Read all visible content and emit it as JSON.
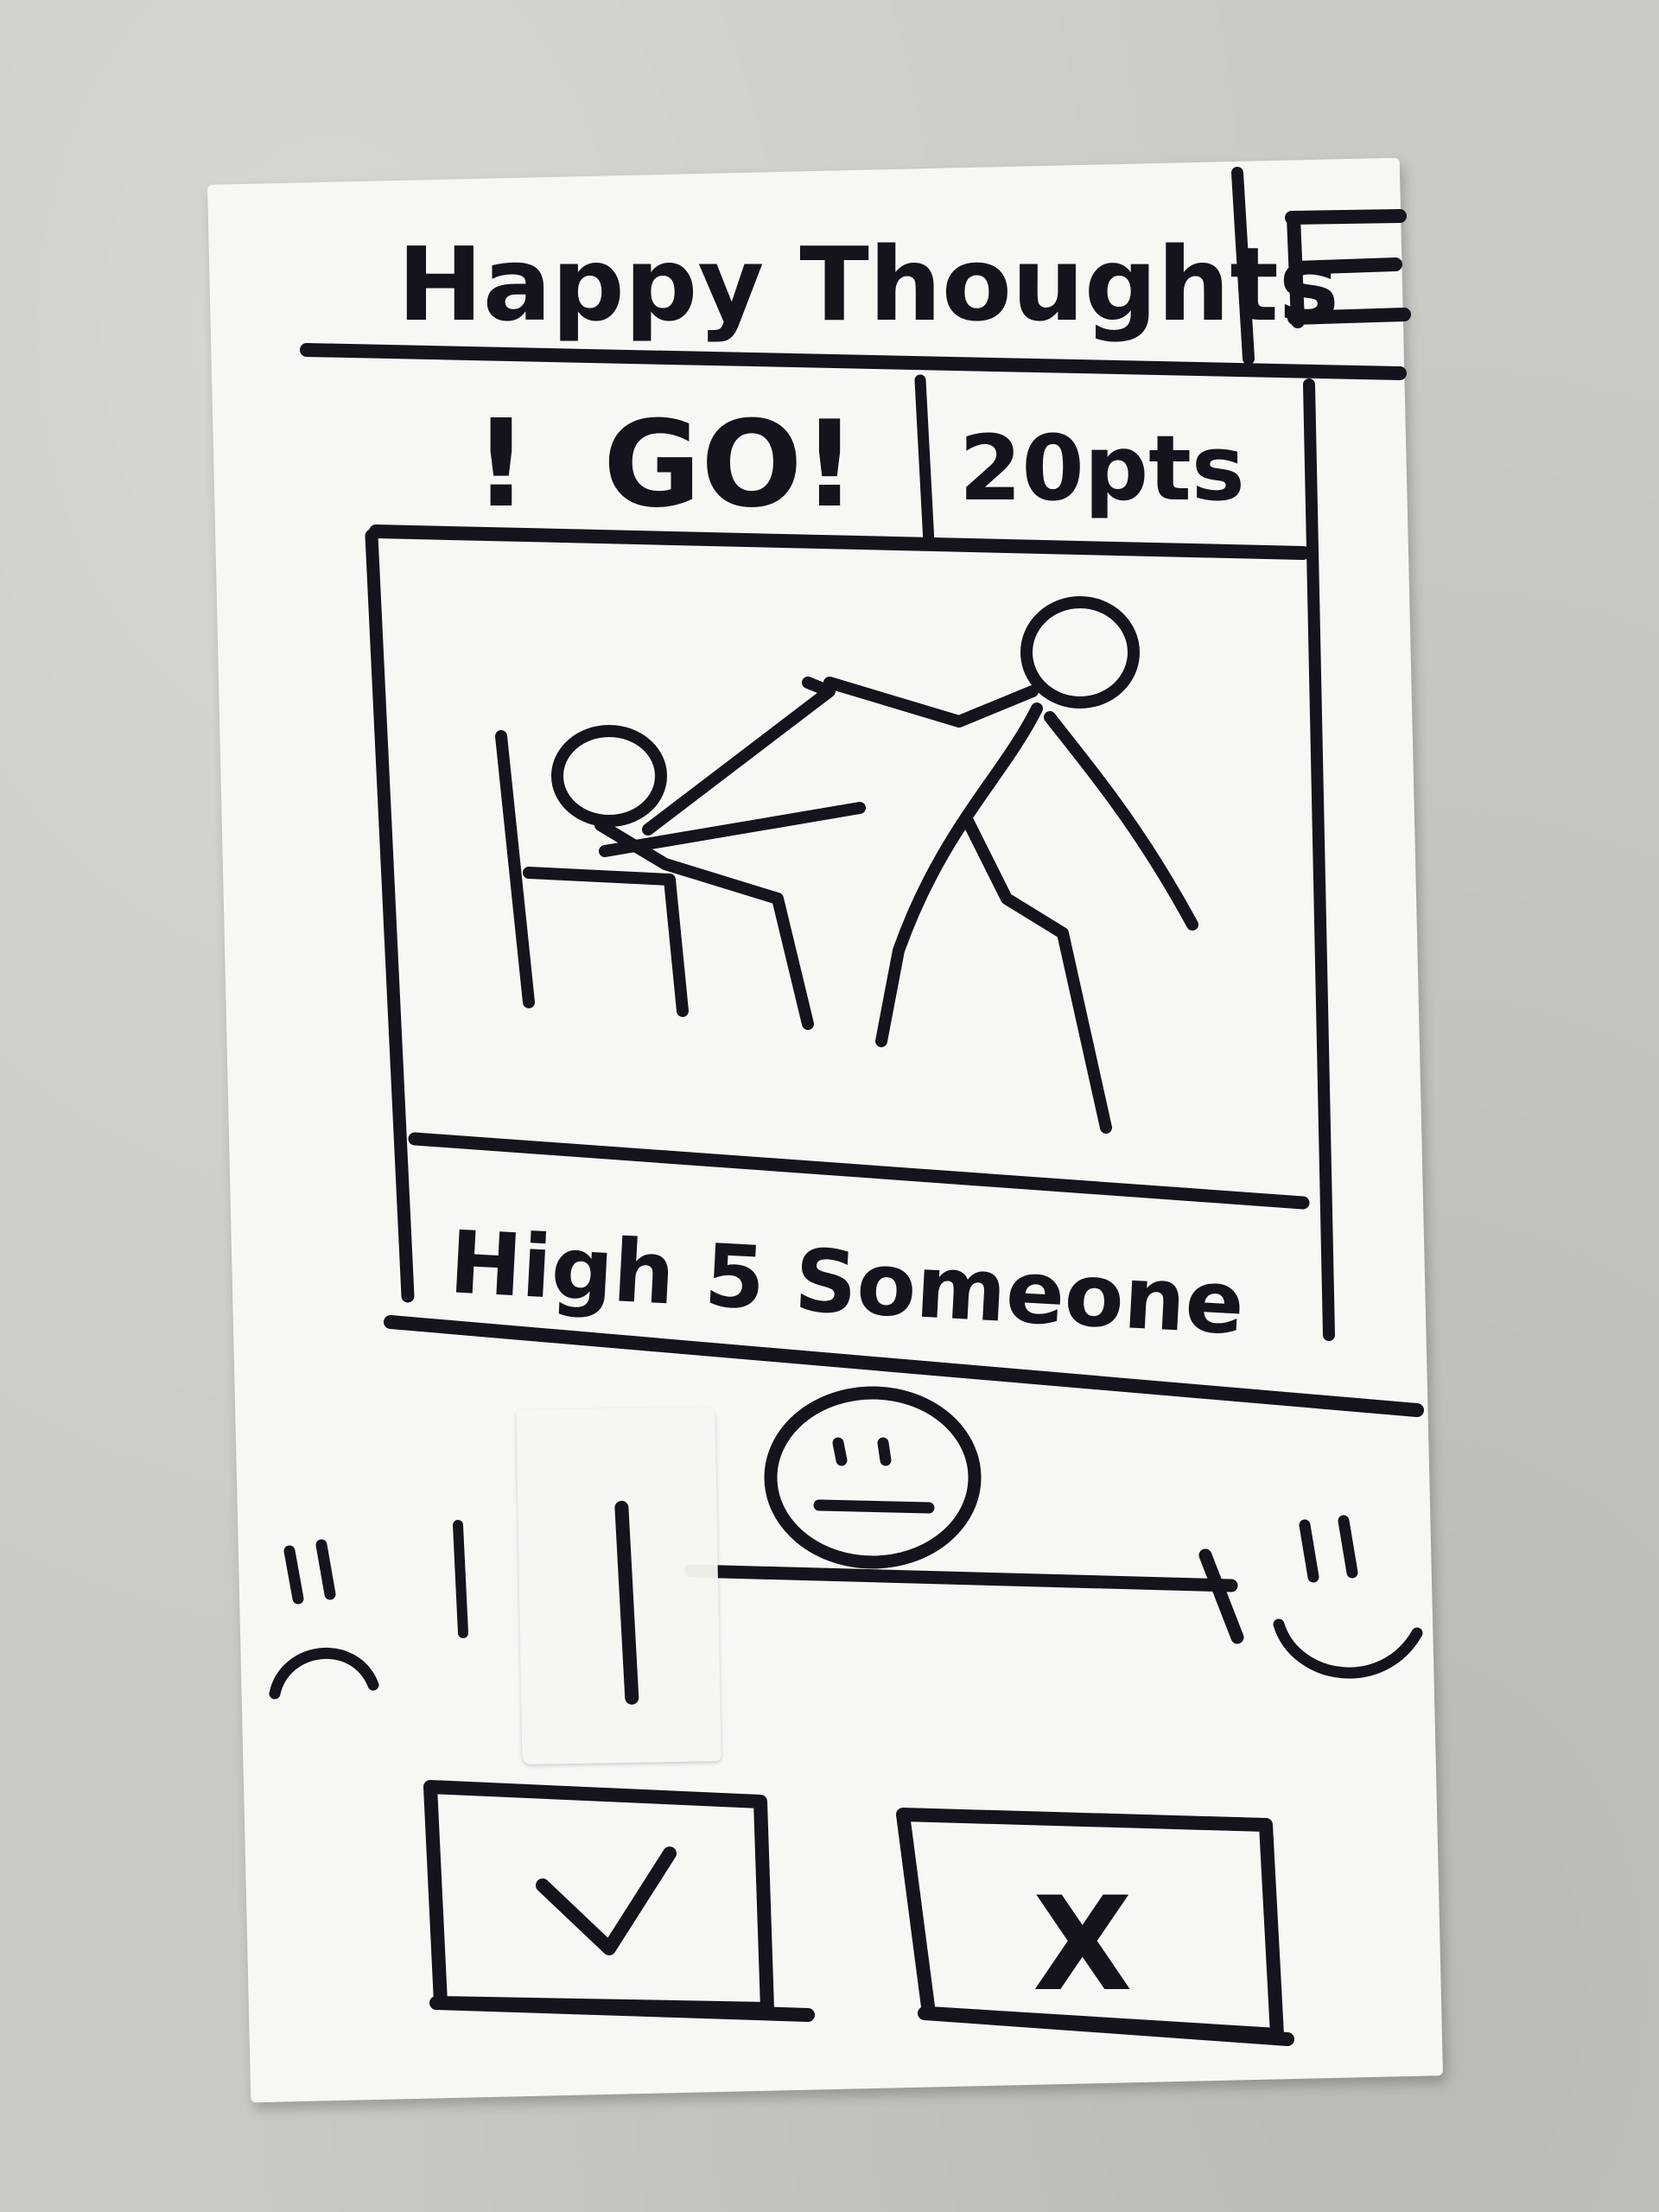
{
  "header": {
    "title": "Happy Thoughts"
  },
  "status": {
    "alert_symbol": "!",
    "go_label": "GO!",
    "points": "20pts"
  },
  "activity": {
    "caption": "High 5 Someone"
  },
  "mood": {
    "level": 0.25
  },
  "actions": {
    "accept_symbol": "✓",
    "reject_symbol": "X"
  },
  "icons": {
    "menu": "hamburger-menu-icon",
    "sad": "sad-face-icon",
    "neutral": "neutral-face-icon",
    "happy": "happy-face-icon",
    "accept": "check-icon",
    "reject": "x-icon"
  },
  "colors": {
    "ink": "#15131c",
    "paper": "#f7f7f4",
    "table": "#c9cac4"
  }
}
